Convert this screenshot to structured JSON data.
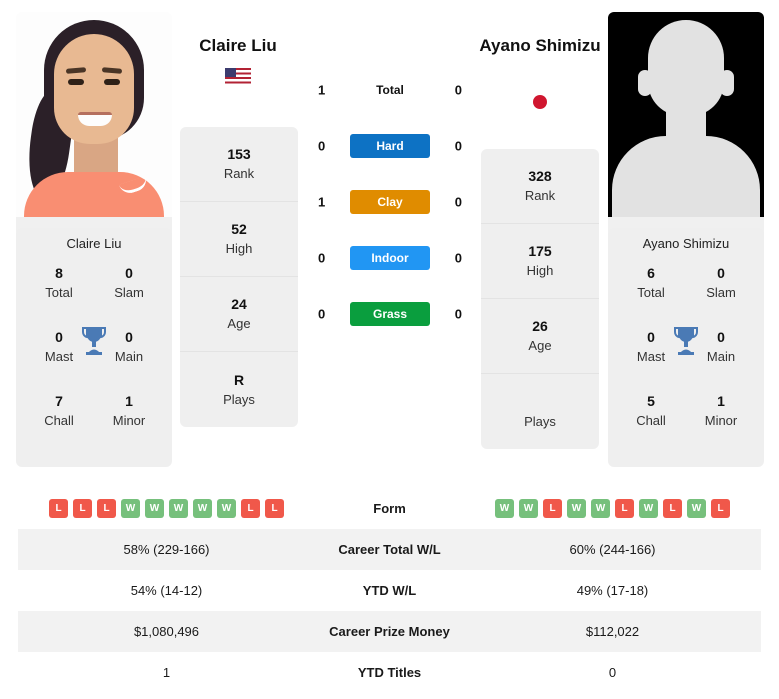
{
  "players": {
    "left": {
      "name": "Claire Liu",
      "flag": "us-flag-icon",
      "photo_caption": "Claire Liu",
      "stats": [
        {
          "value": "153",
          "label": "Rank"
        },
        {
          "value": "52",
          "label": "High"
        },
        {
          "value": "24",
          "label": "Age"
        },
        {
          "value": "R",
          "label": "Plays"
        }
      ],
      "titles": {
        "name": "Claire Liu",
        "total": "8",
        "slam": "0",
        "mast": "0",
        "main": "0",
        "chall": "7",
        "minor": "1"
      },
      "form": [
        "L",
        "L",
        "L",
        "W",
        "W",
        "W",
        "W",
        "W",
        "L",
        "L"
      ],
      "career_total_wl": "58% (229-166)",
      "ytd_wl": "54% (14-12)",
      "career_prize_money": "$1,080,496",
      "ytd_titles": "1"
    },
    "right": {
      "name": "Ayano Shimizu",
      "flag": "jp-flag-icon",
      "photo_caption": "Ayano Shimizu",
      "stats": [
        {
          "value": "328",
          "label": "Rank"
        },
        {
          "value": "175",
          "label": "High"
        },
        {
          "value": "26",
          "label": "Age"
        },
        {
          "value": "",
          "label": "Plays"
        }
      ],
      "titles": {
        "name": "Ayano Shimizu",
        "total": "6",
        "slam": "0",
        "mast": "0",
        "main": "0",
        "chall": "5",
        "minor": "1"
      },
      "form": [
        "W",
        "W",
        "L",
        "W",
        "W",
        "L",
        "W",
        "L",
        "W",
        "L"
      ],
      "career_total_wl": "60% (244-166)",
      "ytd_wl": "49% (17-18)",
      "career_prize_money": "$112,022",
      "ytd_titles": "0"
    }
  },
  "title_labels": {
    "total": "Total",
    "slam": "Slam",
    "mast": "Mast",
    "main": "Main",
    "chall": "Chall",
    "minor": "Minor"
  },
  "surfaces": [
    {
      "label": "Total",
      "left": "1",
      "right": "0",
      "color": "transparent"
    },
    {
      "label": "Hard",
      "left": "0",
      "right": "0",
      "color": "#0d72c4"
    },
    {
      "label": "Clay",
      "left": "1",
      "right": "0",
      "color": "#e08c00"
    },
    {
      "label": "Indoor",
      "left": "0",
      "right": "0",
      "color": "#2196f3"
    },
    {
      "label": "Grass",
      "left": "0",
      "right": "0",
      "color": "#0a9e3e"
    }
  ],
  "table_rows": [
    {
      "label": "Form",
      "key": "form"
    },
    {
      "label": "Career Total W/L",
      "key": "career_total_wl"
    },
    {
      "label": "YTD W/L",
      "key": "ytd_wl"
    },
    {
      "label": "Career Prize Money",
      "key": "career_prize_money"
    },
    {
      "label": "YTD Titles",
      "key": "ytd_titles"
    }
  ],
  "colors": {
    "hard": "#0d72c4",
    "clay": "#e08c00",
    "indoor": "#2196f3",
    "grass": "#0a9e3e",
    "win": "#76c07c",
    "loss": "#f0584a",
    "trophy": "#4a7ab5",
    "panel": "#efefef"
  }
}
